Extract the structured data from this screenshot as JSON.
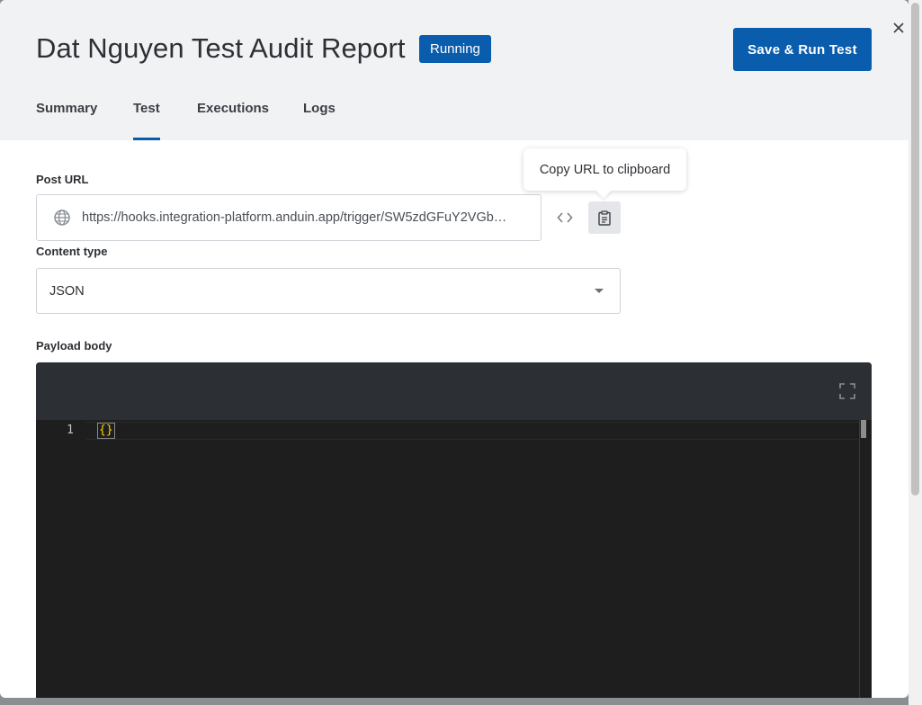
{
  "header": {
    "title": "Dat Nguyen Test Audit Report",
    "status_badge": "Running",
    "primary_action": "Save & Run Test",
    "close_icon": "close-icon"
  },
  "tabs": [
    {
      "label": "Summary",
      "active": false
    },
    {
      "label": "Test",
      "active": true
    },
    {
      "label": "Executions",
      "active": false
    },
    {
      "label": "Logs",
      "active": false
    }
  ],
  "post_url": {
    "label": "Post URL",
    "value": "https://hooks.integration-platform.anduin.app/trigger/SW5zdGFuY2VGb…",
    "icon": "globe-icon",
    "embed_icon": "code-icon",
    "copy_icon": "clipboard-icon",
    "tooltip": "Copy URL to clipboard"
  },
  "content_type": {
    "label": "Content type",
    "selected": "JSON"
  },
  "payload": {
    "label": "Payload body",
    "expand_icon": "fullscreen-icon",
    "lines": [
      {
        "number": "1",
        "text": "{}"
      }
    ]
  },
  "colors": {
    "accent": "#0a5cad",
    "header_bg": "#f1f2f4",
    "editor_bg": "#1e1e1e",
    "editor_toolbar_bg": "#2c2f33",
    "bracket": "#ffd700"
  }
}
